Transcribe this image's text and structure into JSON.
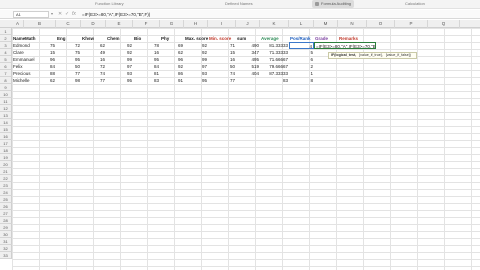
{
  "ribbon": {
    "groups": [
      "Function Library",
      "Defined Names",
      "Formula Auditing",
      "Calculation"
    ],
    "active_button": "Formula Auditing"
  },
  "formula_bar": {
    "name_box": "A1",
    "formula": "=IF(E3>=80,\"A\",IF(E3>=70,\"B\",F))"
  },
  "columns": [
    "A",
    "B",
    "C",
    "D",
    "E",
    "F",
    "G",
    "H",
    "I",
    "J",
    "K",
    "L",
    "M",
    "N",
    "O",
    "P",
    "Q"
  ],
  "rows": [
    "1",
    "2",
    "3",
    "4",
    "5",
    "6",
    "7",
    "8",
    "9",
    "10",
    "11",
    "12",
    "13",
    "14",
    "15",
    "16",
    "17",
    "18",
    "19",
    "20",
    "21",
    "22",
    "23",
    "24",
    "25",
    "26",
    "27",
    "28",
    "29",
    "30",
    "31",
    "32",
    "33"
  ],
  "table": {
    "headers": [
      "Name",
      "Math",
      "Eng",
      "Khsw",
      "Chem",
      "Bio",
      "Phy",
      "Max. score",
      "Min. score",
      "sum",
      "Average",
      "Pos/Rank",
      "Grade",
      "Remarks"
    ],
    "data": [
      [
        "Edmond",
        "75",
        "72",
        "62",
        "92",
        "78",
        "69",
        "92",
        "71",
        "490",
        "81.33333",
        "4",
        "=IF(E3>=80,\"A\",IF(E3>=70,\"B\",F))",
        ""
      ],
      [
        "Clare",
        "15",
        "75",
        "49",
        "92",
        "16",
        "62",
        "92",
        "15",
        "347",
        "71.33333",
        "5",
        "",
        ""
      ],
      [
        "Emmanuel",
        "96",
        "95",
        "16",
        "99",
        "95",
        "96",
        "99",
        "16",
        "495",
        "71.66667",
        "6",
        "",
        ""
      ],
      [
        "Felix",
        "84",
        "50",
        "72",
        "97",
        "84",
        "92",
        "97",
        "50",
        "519",
        "79.66667",
        "2",
        "",
        ""
      ],
      [
        "Precious",
        "88",
        "77",
        "74",
        "93",
        "81",
        "86",
        "93",
        "74",
        "404",
        "87.33333",
        "1",
        "",
        ""
      ],
      [
        "Michelle",
        "62",
        "98",
        "77",
        "95",
        "83",
        "91",
        "95",
        "77",
        "",
        "83",
        "8",
        "",
        ""
      ]
    ]
  },
  "tooltip": {
    "parts": [
      "IF(logical_test,",
      "[value_if_true],",
      "[value_if_false])"
    ]
  }
}
